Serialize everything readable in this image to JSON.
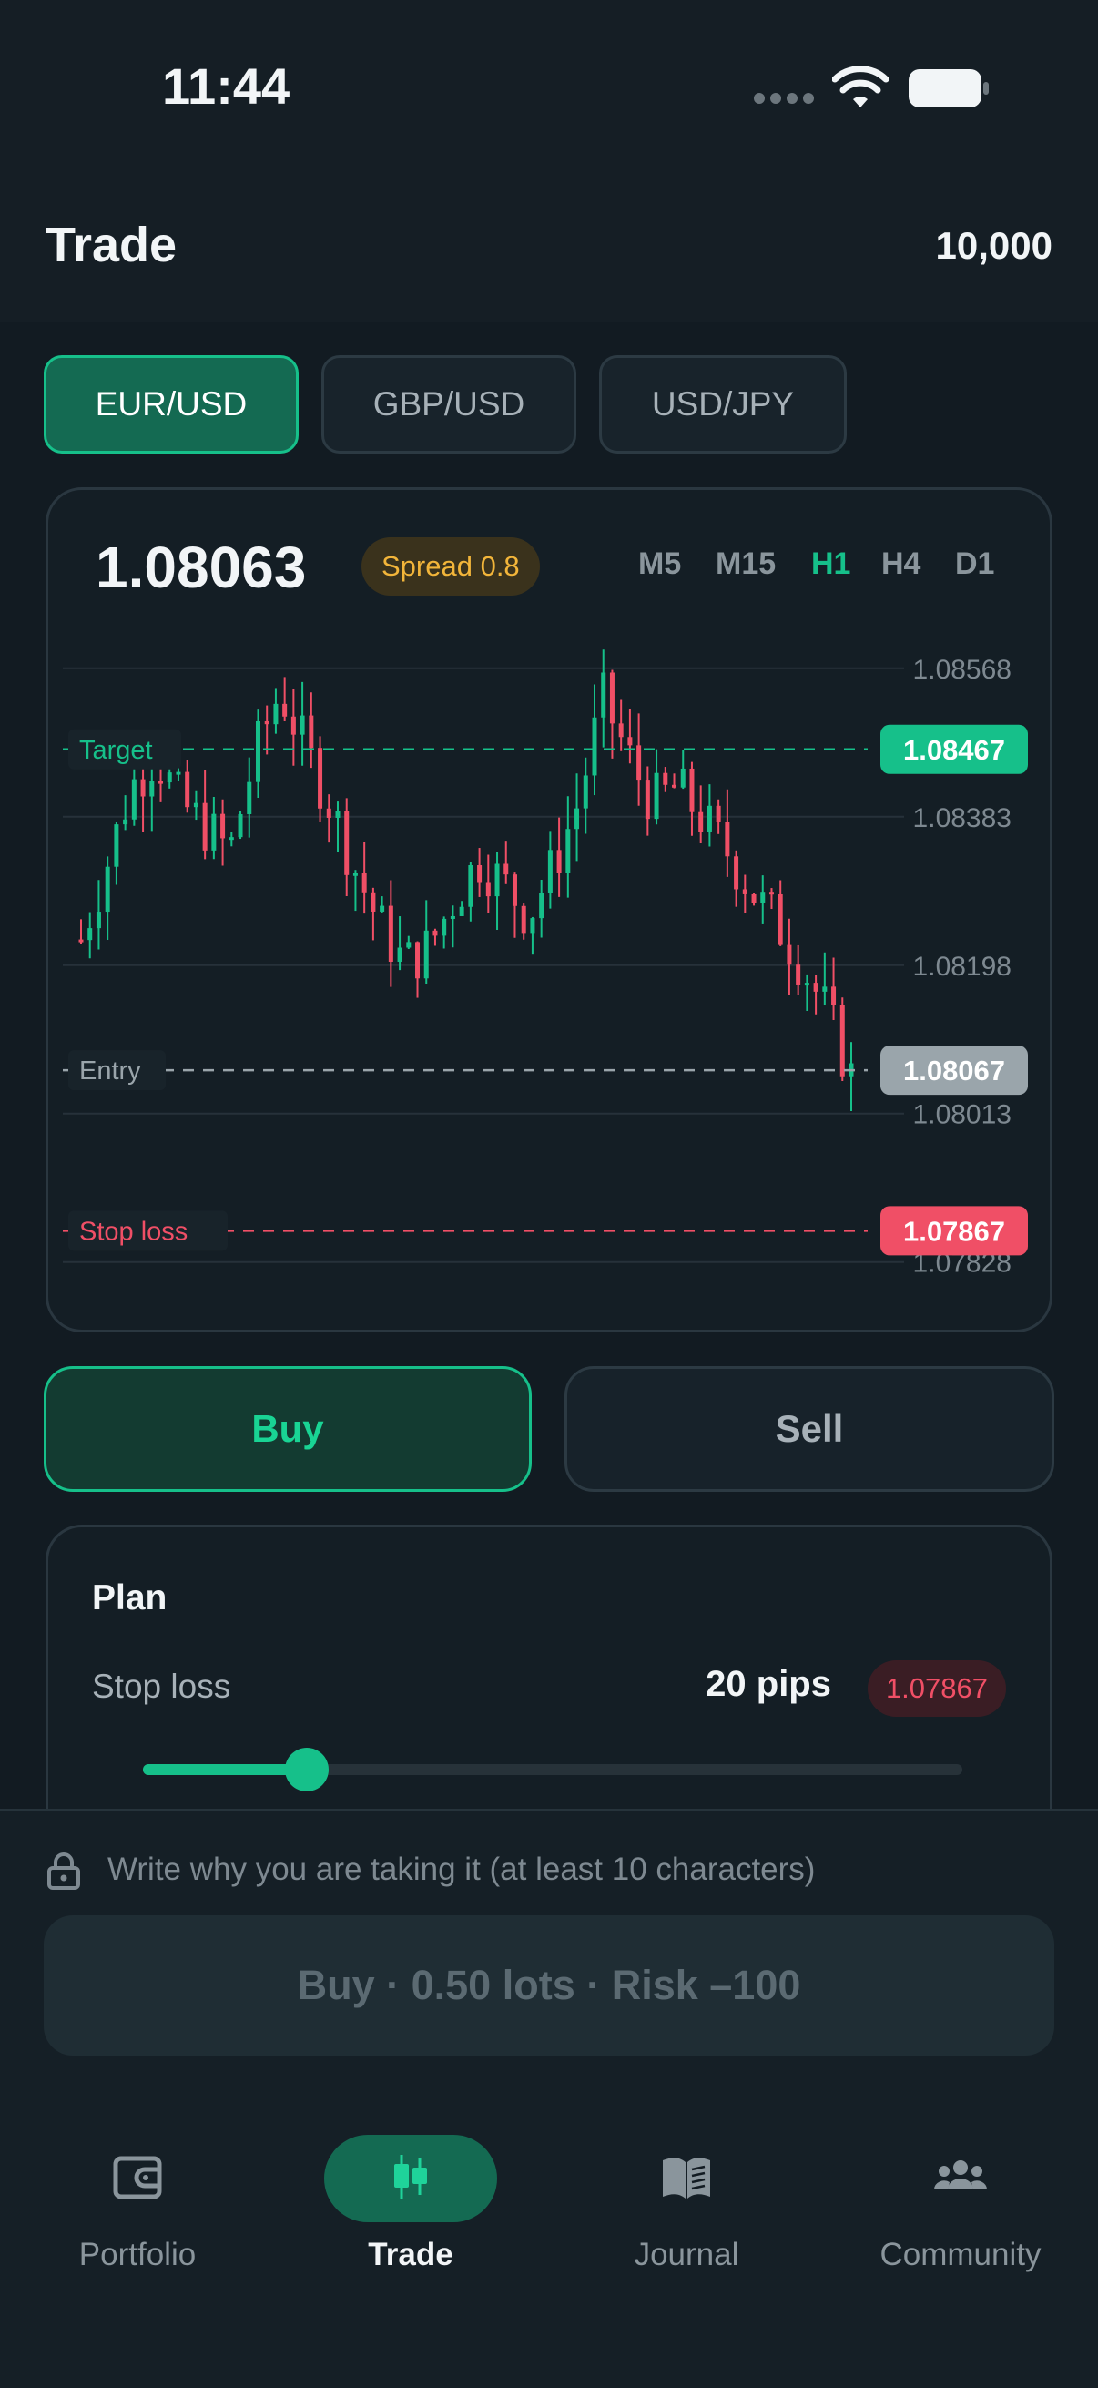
{
  "status": {
    "time": "11:44"
  },
  "header": {
    "title": "Trade",
    "balance": "10,000"
  },
  "pairs": [
    {
      "label": "EUR/USD",
      "active": true
    },
    {
      "label": "GBP/USD",
      "active": false
    },
    {
      "label": "USD/JPY",
      "active": false
    }
  ],
  "quote": {
    "price": "1.08063",
    "spread": "Spread 0.8"
  },
  "timeframes": [
    {
      "label": "M5",
      "active": false
    },
    {
      "label": "M15",
      "active": false
    },
    {
      "label": "H1",
      "active": true
    },
    {
      "label": "H4",
      "active": false
    },
    {
      "label": "D1",
      "active": false
    }
  ],
  "chart_data": {
    "type": "candlestick",
    "ylim": [
      1.0778,
      1.0862
    ],
    "y_ticks": [
      "1.08568",
      "1.08383",
      "1.08198",
      "1.08013",
      "1.07828"
    ],
    "y_tick_values": [
      1.08568,
      1.08383,
      1.08198,
      1.08013,
      1.07828
    ],
    "levels": [
      {
        "name": "Target",
        "value": 1.08467,
        "label": "1.08467",
        "color": "#16c08a"
      },
      {
        "name": "Entry",
        "value": 1.08067,
        "label": "1.08067",
        "color": "#9aa5ab"
      },
      {
        "name": "Stop loss",
        "value": 1.07867,
        "label": "1.07867",
        "color": "#f04f66"
      }
    ],
    "close_trend": [
      1.0823,
      1.0832,
      1.0842,
      1.0846,
      1.084,
      1.0837,
      1.0834,
      1.0846,
      1.0854,
      1.0847,
      1.084,
      1.0832,
      1.0825,
      1.082,
      1.0822,
      1.0828,
      1.0833,
      1.083,
      1.0826,
      1.0832,
      1.084,
      1.0853,
      1.0846,
      1.084,
      1.0842,
      1.0838,
      1.0834,
      1.0829,
      1.0825,
      1.082,
      1.0814,
      1.0806
    ]
  },
  "actions": {
    "buy": "Buy",
    "sell": "Sell"
  },
  "plan": {
    "title": "Plan",
    "stop_loss_label": "Stop loss",
    "stop_loss_pips": "20 pips",
    "stop_loss_price": "1.07867",
    "slider_fraction": 0.2
  },
  "order": {
    "reason_placeholder": "Write why you are taking it (at least 10 characters)",
    "submit_label": "Buy · 0.50 lots · Risk –100"
  },
  "nav": [
    {
      "label": "Portfolio",
      "icon": "wallet-icon",
      "active": false
    },
    {
      "label": "Trade",
      "icon": "candlestick-icon",
      "active": true
    },
    {
      "label": "Journal",
      "icon": "book-icon",
      "active": false
    },
    {
      "label": "Community",
      "icon": "people-icon",
      "active": false
    }
  ],
  "colors": {
    "accent": "#16c08a",
    "up": "#16c08a",
    "down": "#f04f66",
    "background": "#121b22",
    "card": "#141e25"
  }
}
